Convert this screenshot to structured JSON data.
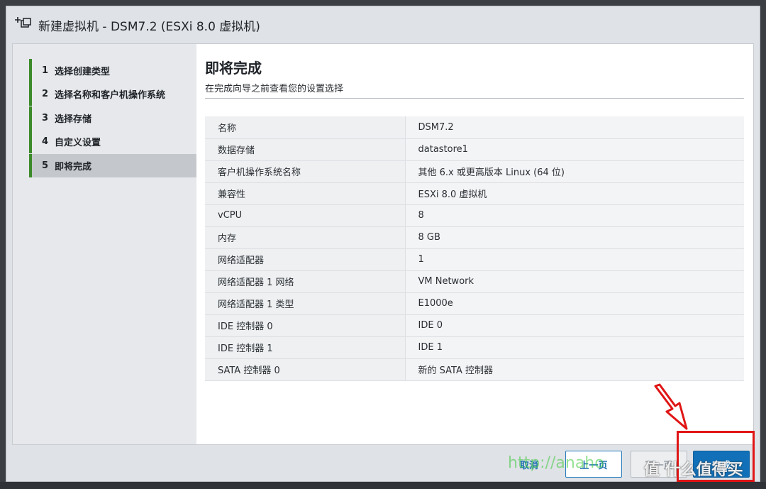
{
  "dialog": {
    "title": "新建虚拟机 - DSM7.2 (ESXi 8.0 虚拟机)",
    "icon": "new-vm-icon"
  },
  "steps": [
    {
      "num": "1",
      "label": "选择创建类型"
    },
    {
      "num": "2",
      "label": "选择名称和客户机操作系统"
    },
    {
      "num": "3",
      "label": "选择存储"
    },
    {
      "num": "4",
      "label": "自定义设置"
    },
    {
      "num": "5",
      "label": "即将完成",
      "active": true
    }
  ],
  "main": {
    "heading": "即将完成",
    "subtitle": "在完成向导之前查看您的设置选择"
  },
  "summary": [
    {
      "key": "名称",
      "value": "DSM7.2"
    },
    {
      "key": "数据存储",
      "value": "datastore1"
    },
    {
      "key": "客户机操作系统名称",
      "value": "其他 6.x 或更高版本 Linux (64 位)"
    },
    {
      "key": "兼容性",
      "value": "ESXi 8.0 虚拟机"
    },
    {
      "key": "vCPU",
      "value": "8"
    },
    {
      "key": "内存",
      "value": "8 GB"
    },
    {
      "key": "网络适配器",
      "value": "1"
    },
    {
      "key": "网络适配器 1 网络",
      "value": "VM Network"
    },
    {
      "key": "网络适配器 1 类型",
      "value": "E1000e"
    },
    {
      "key": "IDE 控制器 0",
      "value": "IDE 0"
    },
    {
      "key": "IDE 控制器 1",
      "value": "IDE 1"
    },
    {
      "key": "SATA 控制器 0",
      "value": "新的 SATA 控制器"
    }
  ],
  "footer": {
    "cancel": "取消",
    "back": "上一页",
    "next": "下一页",
    "finish": "完成"
  },
  "watermark": {
    "url": "http://anaho",
    "brand": "值 什么值得买"
  },
  "colors": {
    "accent": "#1170b8",
    "step_bar": "#3c8a29",
    "highlight": "#e01515"
  }
}
